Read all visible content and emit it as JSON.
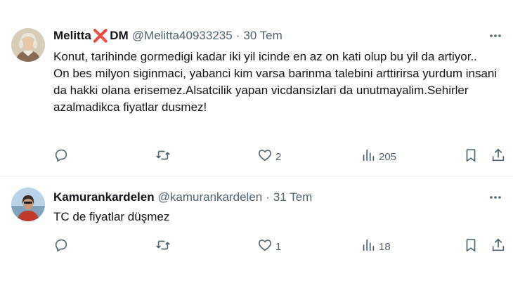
{
  "tweets": [
    {
      "display_name": "Melitta",
      "name_mark": "❌",
      "name_suffix": "DM",
      "handle": "@Melitta40933235",
      "separator": "·",
      "date": "30 Tem",
      "text_lines": [
        "Konut, tarihinde gormedigi kadar iki yil icinde en az on kati olup bu yil da artiyor..",
        "On bes milyon siginmaci, yabanci kim varsa barinma talebini arttirirsa yurdum insani da hakki olana erisemez.Alsatcilik yapan vicdansizlari da unutmayalim.Sehirler azalmadikca fiyatlar dusmez!"
      ],
      "replies": "",
      "retweets": "",
      "likes": "2",
      "views": "205"
    },
    {
      "display_name": "Kamurankardelen",
      "handle": "@kamurankardelen",
      "separator": "·",
      "date": "31 Tem",
      "text_lines": [
        "TC de fiyatlar düşmez"
      ],
      "replies": "",
      "retweets": "",
      "likes": "1",
      "views": "18"
    }
  ],
  "icons": {
    "reply": "reply-icon",
    "retweet": "retweet-icon",
    "like": "heart-icon",
    "views": "views-icon",
    "bookmark": "bookmark-icon",
    "share": "share-icon",
    "more": "more-icon"
  },
  "colors": {
    "text": "#0f1419",
    "secondary": "#536471",
    "x_mark": "#e0245e",
    "divider": "#eff3f4"
  }
}
